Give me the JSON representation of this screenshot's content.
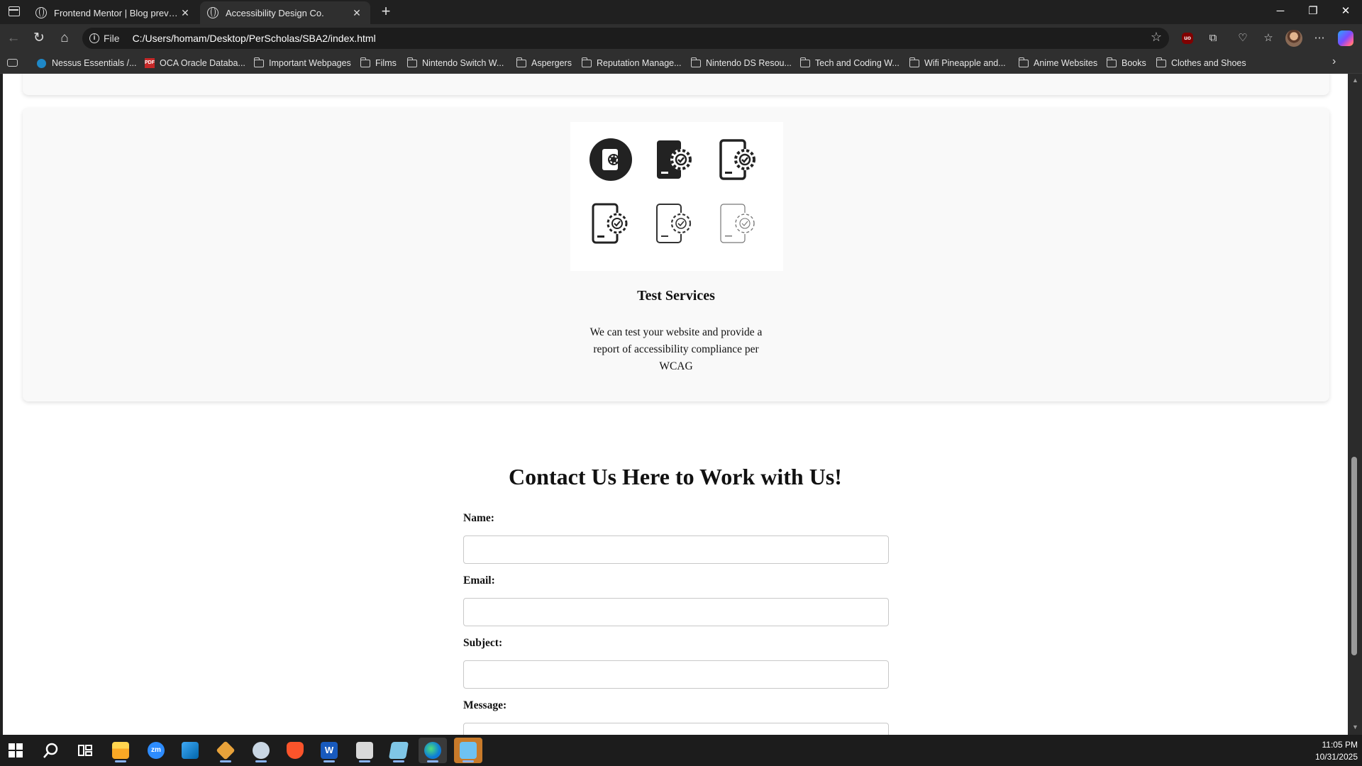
{
  "browser": {
    "tabs": [
      {
        "title": "Frontend Mentor | Blog preview card"
      },
      {
        "title": "Accessibility Design Co."
      }
    ],
    "address": {
      "scheme_label": "File",
      "url": "C:/Users/homam/Desktop/PerScholas/SBA2/index.html"
    },
    "bookmarks": [
      "Nessus Essentials /...",
      "OCA Oracle Databa...",
      "Important Webpages",
      "Films",
      "Nintendo Switch W...",
      "Aspergers",
      "Reputation Manage...",
      "Nintendo DS Resou...",
      "Tech and Coding W...",
      "Wifi Pineapple and...",
      "Anime Websites",
      "Books",
      "Clothes and Shoes"
    ]
  },
  "page": {
    "service_card": {
      "title": "Test Services",
      "description": "We can test your website and provide a report of accessibility compliance per WCAG"
    },
    "contact": {
      "heading": "Contact Us Here to Work with Us!",
      "fields": [
        {
          "label": "Name:"
        },
        {
          "label": "Email:"
        },
        {
          "label": "Subject:"
        },
        {
          "label": "Message:"
        }
      ]
    }
  },
  "taskbar": {
    "apps": [
      "Start",
      "Search",
      "Task View",
      "File Explorer",
      "Zoom",
      "Visual Studio Code",
      "Git",
      "App",
      "Brave",
      "Word",
      "App",
      "Notepad",
      "Microsoft Edge",
      "Paint"
    ],
    "clock": {
      "time": "11:05 PM",
      "date": "10/31/2025"
    }
  },
  "colors": {
    "accent": "#8ab4f8",
    "chrome": "#2f2f2f",
    "card": "#f9f9f9"
  }
}
